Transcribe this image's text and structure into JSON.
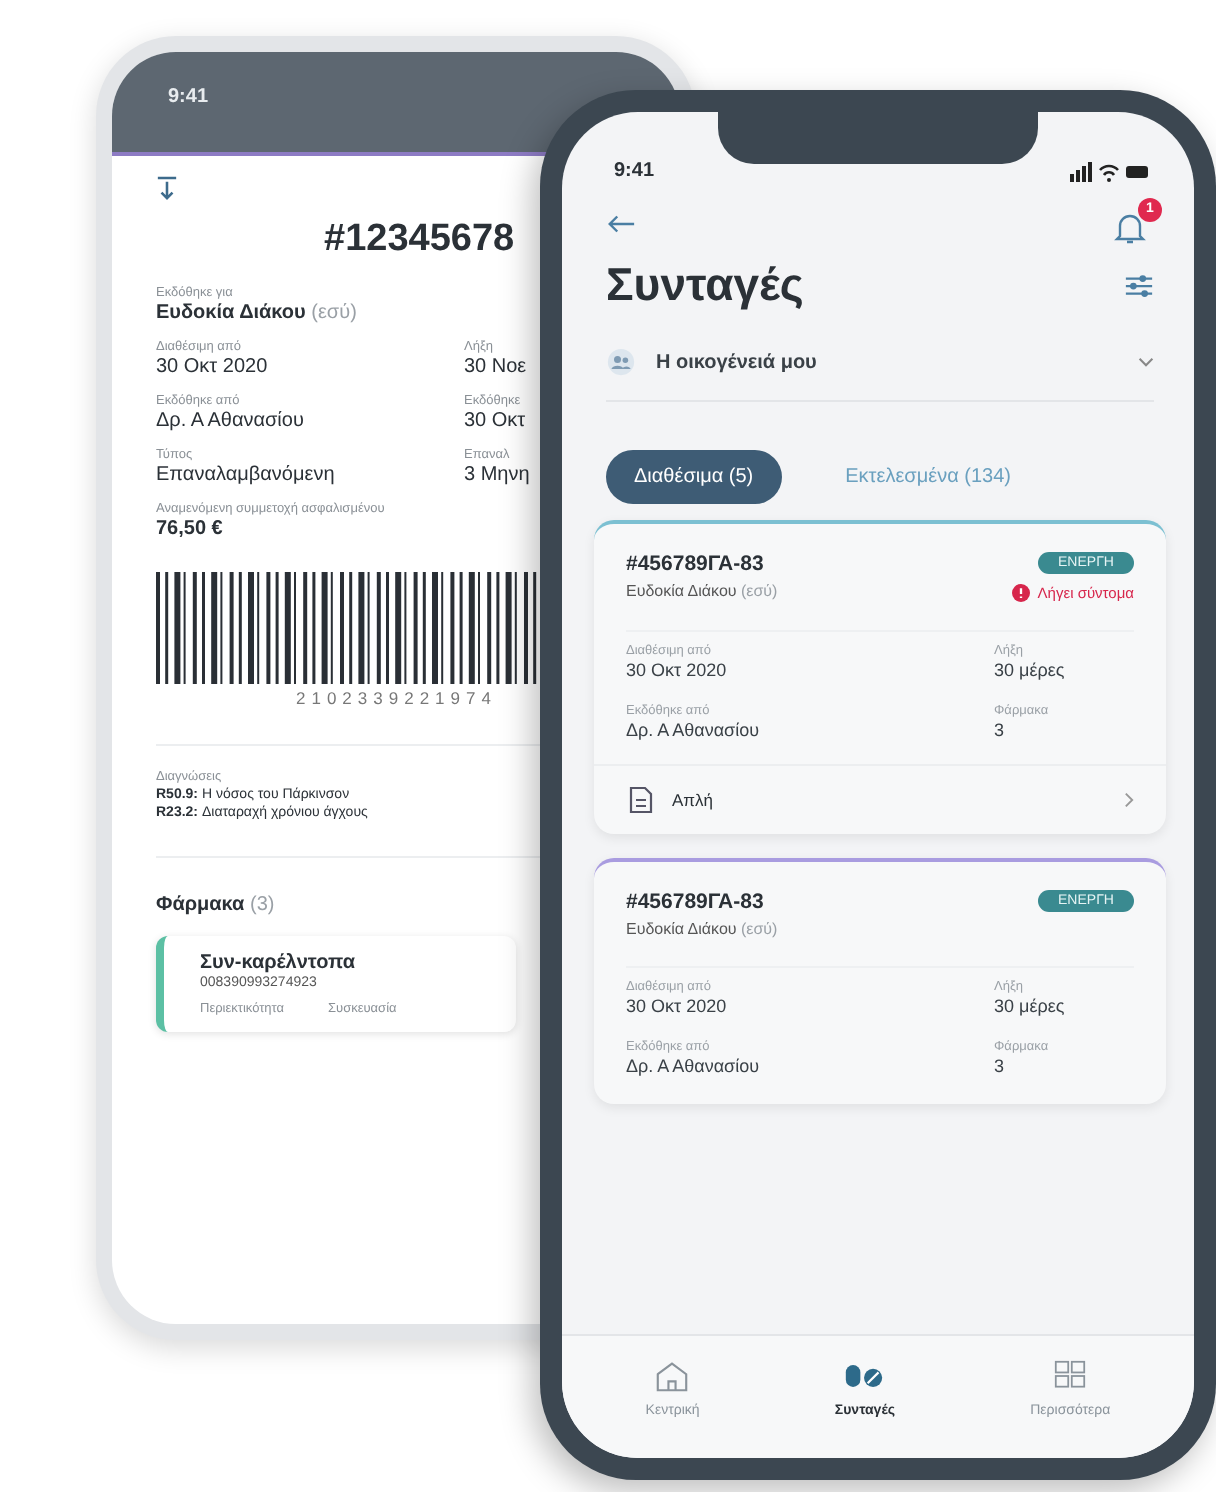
{
  "back_screen": {
    "status_time": "9:41",
    "prescription_number": "#12345678",
    "issued_for": {
      "label": "Εκδόθηκε για",
      "name": "Ευδοκία Διάκου",
      "relation": "(εσύ)"
    },
    "fields": [
      {
        "label": "Διαθέσιμη από",
        "value": "30 Οκτ 2020"
      },
      {
        "label": "Λήξη",
        "value": "30 Νοε"
      },
      {
        "label": "Εκδόθηκε από",
        "value": "Δρ. Α Αθανασίου"
      },
      {
        "label": "Εκδόθηκε",
        "value": "30 Οκτ"
      },
      {
        "label": "Τύπος",
        "value": "Επαναλαμβανόμενη"
      },
      {
        "label": "Επαναλ",
        "value": "3 Μηνη"
      }
    ],
    "cost": {
      "label": "Αναμενόμενη συμμετοχή ασφαλισμένου",
      "value": "76,50 €"
    },
    "barcode_number": "2102339221974",
    "diagnoses": {
      "label": "Διαγνώσεις",
      "items": [
        "**R50.9:** Η νόσος του Πάρκινσον",
        "**R23.2:** Διαταραχή χρόνιου άγχους"
      ]
    },
    "drugs": {
      "title": "Φάρμακα",
      "count": "(3)"
    },
    "drug": {
      "name": "Συν-καρέλντοπα",
      "code": "008390993274923",
      "labels": [
        "Περιεκτικότητα",
        "Συσκευασία"
      ]
    }
  },
  "front_screen": {
    "status_time": "9:41",
    "notification_count": "1",
    "title": "Συνταγές",
    "family_selector": "Η οικογένειά μου",
    "tabs": [
      {
        "label": "Διαθέσιμα (5)",
        "selected": true
      },
      {
        "label": "Εκτελεσμένα (134)",
        "selected": false
      }
    ],
    "cards": [
      {
        "number": "#456789ΓΑ-83",
        "patient": "Ευδοκία Διάκου",
        "relation": "(εσύ)",
        "status": "ΕΝΕΡΓΗ",
        "warning": "Λήγει σύντομα",
        "fields": [
          {
            "label": "Διαθέσιμη από",
            "value": "30 Οκτ 2020"
          },
          {
            "label": "Λήξη",
            "value": "30 μέρες"
          },
          {
            "label": "Εκδόθηκε από",
            "value": "Δρ. Α Αθανασίου"
          },
          {
            "label": "Φάρμακα",
            "value": "3"
          }
        ],
        "footer": "Απλή"
      },
      {
        "number": "#456789ΓΑ-83",
        "patient": "Ευδοκία Διάκου",
        "relation": "(εσύ)",
        "status": "ΕΝΕΡΓΗ",
        "fields": [
          {
            "label": "Διαθέσιμη από",
            "value": "30 Οκτ 2020"
          },
          {
            "label": "Λήξη",
            "value": "30 μέρες"
          },
          {
            "label": "Εκδόθηκε από",
            "value": "Δρ. Α Αθανασίου"
          },
          {
            "label": "Φάρμακα",
            "value": "3"
          }
        ]
      }
    ],
    "nav": [
      {
        "kind": "home",
        "label": "Κεντρική",
        "selected": false
      },
      {
        "kind": "pills",
        "label": "Συνταγές",
        "selected": true
      },
      {
        "kind": "more",
        "label": "Περισσότερα",
        "selected": false
      }
    ]
  }
}
